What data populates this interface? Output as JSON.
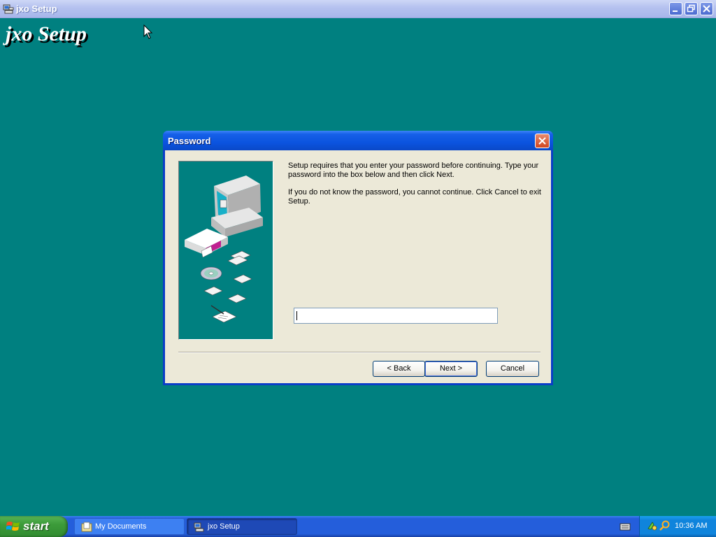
{
  "window": {
    "title": "jxo Setup",
    "banner": "jxo Setup"
  },
  "dialog": {
    "title": "Password",
    "message_1": "Setup requires that you enter your password before continuing. Type your password into the box below and then click Next.",
    "message_2": "If you do not know the password, you cannot continue. Click Cancel to exit Setup.",
    "password_value": "",
    "buttons": {
      "back": "< Back",
      "next": "Next >",
      "cancel": "Cancel"
    }
  },
  "taskbar": {
    "start_label": "start",
    "tasks": [
      {
        "label": "My Documents",
        "icon": "folder-icon",
        "active": false
      },
      {
        "label": "jxo Setup",
        "icon": "setup-icon",
        "active": true
      }
    ],
    "clock": "10:36 AM"
  },
  "colors": {
    "desktop": "#008080",
    "dialog_title": "#0a54df",
    "taskbar": "#245edb",
    "start": "#3c9b3a"
  }
}
